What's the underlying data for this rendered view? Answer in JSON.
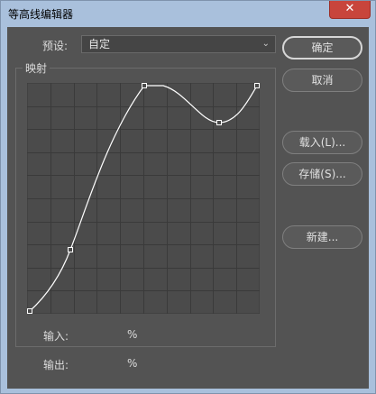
{
  "window": {
    "title": "等高线编辑器",
    "close_label": "✕"
  },
  "preset": {
    "label": "预设:",
    "value": "自定"
  },
  "mapping": {
    "title": "映射"
  },
  "buttons": {
    "ok": "确定",
    "cancel": "取消",
    "load": "载入(L)...",
    "save": "存储(S)...",
    "new": "新建..."
  },
  "fields": {
    "input_label": "输入:",
    "input_unit": "%",
    "output_label": "输出:",
    "output_unit": "%"
  },
  "colors": {
    "panel_bg": "#535353",
    "grid_bg": "#4b4b4b",
    "grid_line": "#3a3a3a",
    "curve": "#ffffff",
    "title_bar": "#a9c0dc",
    "close_button": "#c8453c"
  },
  "icons": {
    "close": "close-icon",
    "dropdown": "chevron-down-icon"
  }
}
